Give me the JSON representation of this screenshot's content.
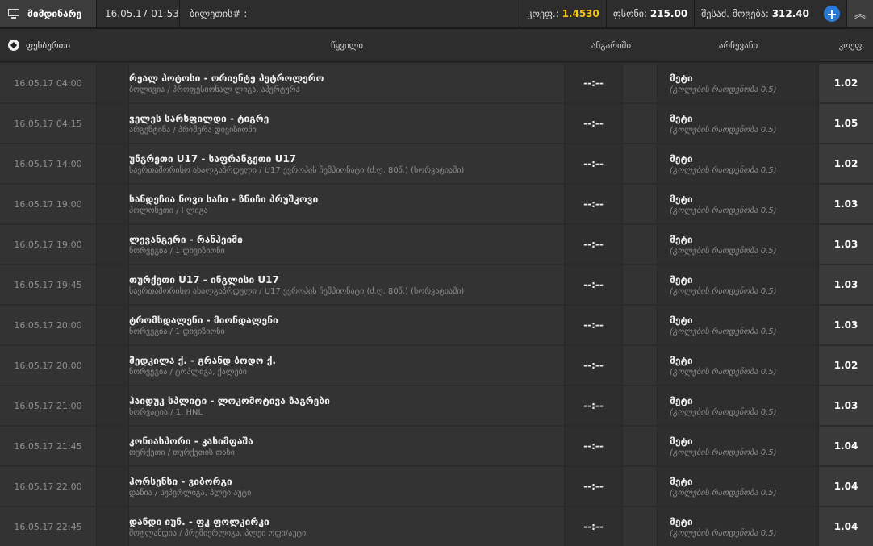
{
  "header": {
    "title": "მიმდინარე",
    "date": "16.05.17 01:53",
    "ticket_label": "ბილეთის# :",
    "coef_label": "კოეფ.:",
    "coef_value": "1.4530",
    "stake_label": "ფსონი:",
    "stake_value": "215.00",
    "win_label": "შესაძ. მოგება:",
    "win_value": "312.40",
    "add_symbol": "+",
    "collapse_symbol": "︽"
  },
  "columns": {
    "sport": "ფეხბურთი",
    "event": "წყვილი",
    "score": "ანგარიში",
    "outcome": "არჩევანი",
    "odd": "კოეფ."
  },
  "rows": [
    {
      "time": "16.05.17 04:00",
      "name": "რეალ პოტოსი - ორიენტე პეტროლერო",
      "league": "ბოლივია / პროფესიონალ ლიგა, აპერტურა",
      "score": "--:--",
      "outcome": "მეტი",
      "outcome_desc": "(გოლების რაოდენობა 0.5)",
      "odd": "1.02"
    },
    {
      "time": "16.05.17 04:15",
      "name": "ველეს სარსფილდი - ტიგრე",
      "league": "არგენტინა / პრიმერა დივიზიონი",
      "score": "--:--",
      "outcome": "მეტი",
      "outcome_desc": "(გოლების რაოდენობა 0.5)",
      "odd": "1.05"
    },
    {
      "time": "16.05.17 14:00",
      "name": "უნგრეთი U17 - საფრანგეთი U17",
      "league": "საერთაშორისო ახალგაზრდული / U17 ევროპის ჩემპიონატი (ძ.ღ. 80წ.) (ხორვატიაში)",
      "score": "--:--",
      "outcome": "მეტი",
      "outcome_desc": "(გოლების რაოდენობა 0.5)",
      "odd": "1.02"
    },
    {
      "time": "16.05.17 19:00",
      "name": "სანდეჩია ნოვი საჩი - ზნიჩი პრუშკოვი",
      "league": "პოლონეთი / I ლიგა",
      "score": "--:--",
      "outcome": "მეტი",
      "outcome_desc": "(გოლების რაოდენობა 0.5)",
      "odd": "1.03"
    },
    {
      "time": "16.05.17 19:00",
      "name": "ლევანგერი - რანჰეიმი",
      "league": "ნორვეგია / 1 დივიზიონი",
      "score": "--:--",
      "outcome": "მეტი",
      "outcome_desc": "(გოლების რაოდენობა 0.5)",
      "odd": "1.03"
    },
    {
      "time": "16.05.17 19:45",
      "name": "თურქეთი U17 - ინგლისი U17",
      "league": "საერთაშორისო ახალგაზრდული / U17 ევროპის ჩემპიონატი (ძ.ღ. 80წ.) (ხორვატიაში)",
      "score": "--:--",
      "outcome": "მეტი",
      "outcome_desc": "(გოლების რაოდენობა 0.5)",
      "odd": "1.03"
    },
    {
      "time": "16.05.17 20:00",
      "name": "ტრომსდალენი - მიონდალენი",
      "league": "ნორვეგია / 1 დივიზიონი",
      "score": "--:--",
      "outcome": "მეტი",
      "outcome_desc": "(გოლების რაოდენობა 0.5)",
      "odd": "1.03"
    },
    {
      "time": "16.05.17 20:00",
      "name": "მედკილა ქ. - გრანდ ბოდო ქ.",
      "league": "ნორვეგია / ტოპლიგა, ქალები",
      "score": "--:--",
      "outcome": "მეტი",
      "outcome_desc": "(გოლების რაოდენობა 0.5)",
      "odd": "1.02"
    },
    {
      "time": "16.05.17 21:00",
      "name": "ჰაიდუკ სპლიტი - ლოკომოტივა ზაგრები",
      "league": "ხორვატია / 1. HNL",
      "score": "--:--",
      "outcome": "მეტი",
      "outcome_desc": "(გოლების რაოდენობა 0.5)",
      "odd": "1.03"
    },
    {
      "time": "16.05.17 21:45",
      "name": "კონიასპორი - კასიმფაშა",
      "league": "თურქეთი / თურქეთის თასი",
      "score": "--:--",
      "outcome": "მეტი",
      "outcome_desc": "(გოლების რაოდენობა 0.5)",
      "odd": "1.04"
    },
    {
      "time": "16.05.17 22:00",
      "name": "ჰორსენსი - ვიბორგი",
      "league": "დანია / სუპერლიგა, პლეი აუტი",
      "score": "--:--",
      "outcome": "მეტი",
      "outcome_desc": "(გოლების რაოდენობა 0.5)",
      "odd": "1.04"
    },
    {
      "time": "16.05.17 22:45",
      "name": "დანდი იუნ. - ფკ ფოლკირკი",
      "league": "შოტლანდია / პრემიერლიგა, პლეი ოფი/აუტი",
      "score": "--:--",
      "outcome": "მეტი",
      "outcome_desc": "(გოლების რაოდენობა 0.5)",
      "odd": "1.04"
    }
  ]
}
